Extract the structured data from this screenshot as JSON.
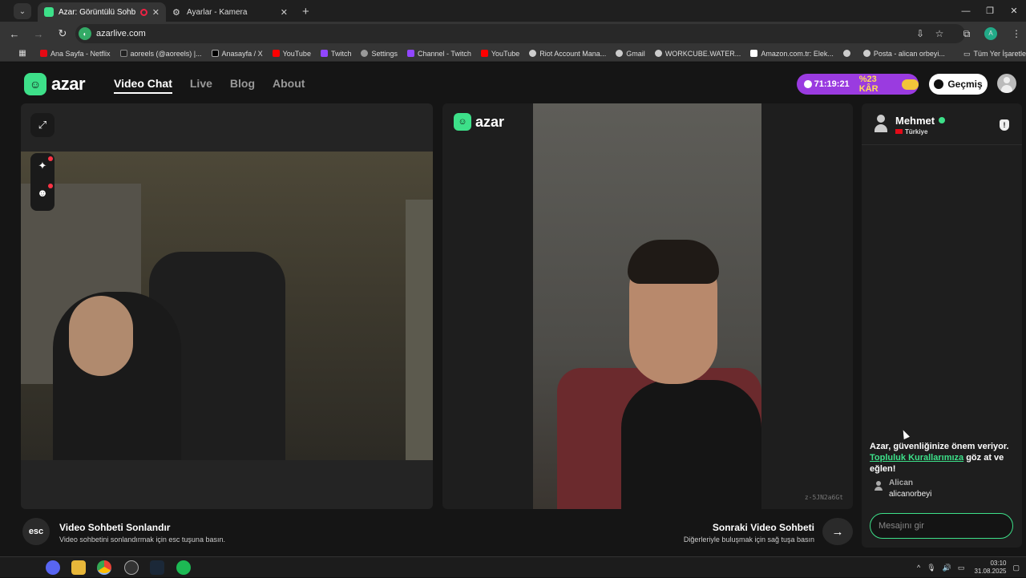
{
  "browser": {
    "tabs": [
      {
        "title": "Azar: Görüntülü Sohbet, Arka",
        "active": true
      },
      {
        "title": "Ayarlar - Kamera",
        "active": false
      }
    ],
    "url": "azarlive.com",
    "profile_initial": "A",
    "bookmarks": [
      "Ana Sayfa - Netflix",
      "aoreels (@aoreels) |...",
      "Anasayfa / X",
      "YouTube",
      "Twitch",
      "Settings",
      "Channel - Twitch",
      "YouTube",
      "Riot Account Mana...",
      "Gmail",
      "WORKCUBE.WATER...",
      "Amazon.com.tr: Elek...",
      "",
      "Posta - alican orbeyi..."
    ],
    "all_bookmarks": "Tüm Yer İşaretle"
  },
  "site": {
    "logo": "azar",
    "nav": [
      {
        "label": "Video Chat",
        "active": true
      },
      {
        "label": "Live",
        "active": false
      },
      {
        "label": "Blog",
        "active": false
      },
      {
        "label": "About",
        "active": false
      }
    ],
    "promo": {
      "timer": "71:19:21",
      "discount": "%23 KÂR"
    },
    "history": "Geçmiş"
  },
  "video": {
    "remote_logo": "azar",
    "watermark": "z-5JN2a6Gt"
  },
  "controls": {
    "esc_key": "esc",
    "end_title": "Video Sohbeti Sonlandır",
    "end_sub": "Video sohbetini sonlandırmak için esc tuşuna basın.",
    "next_title": "Sonraki Video Sohbeti",
    "next_sub": "Diğerleriyle buluşmak için sağ tuşa basın"
  },
  "chat": {
    "peer_name": "Mehmet",
    "peer_country": "Türkiye",
    "notice_1": "Azar, güvenliğinize önem veriyor.",
    "notice_link": "Topluluk Kurallarımıza",
    "notice_2": " göz at ve eğlen!",
    "sys_user": "Alican",
    "sys_msg": "alicanorbeyi",
    "input_placeholder": "Mesajını gir"
  },
  "taskbar": {
    "time": "03:10",
    "date": "31.08.2025"
  },
  "colors": {
    "accent": "#3de089",
    "promo": "#9a3be0"
  }
}
